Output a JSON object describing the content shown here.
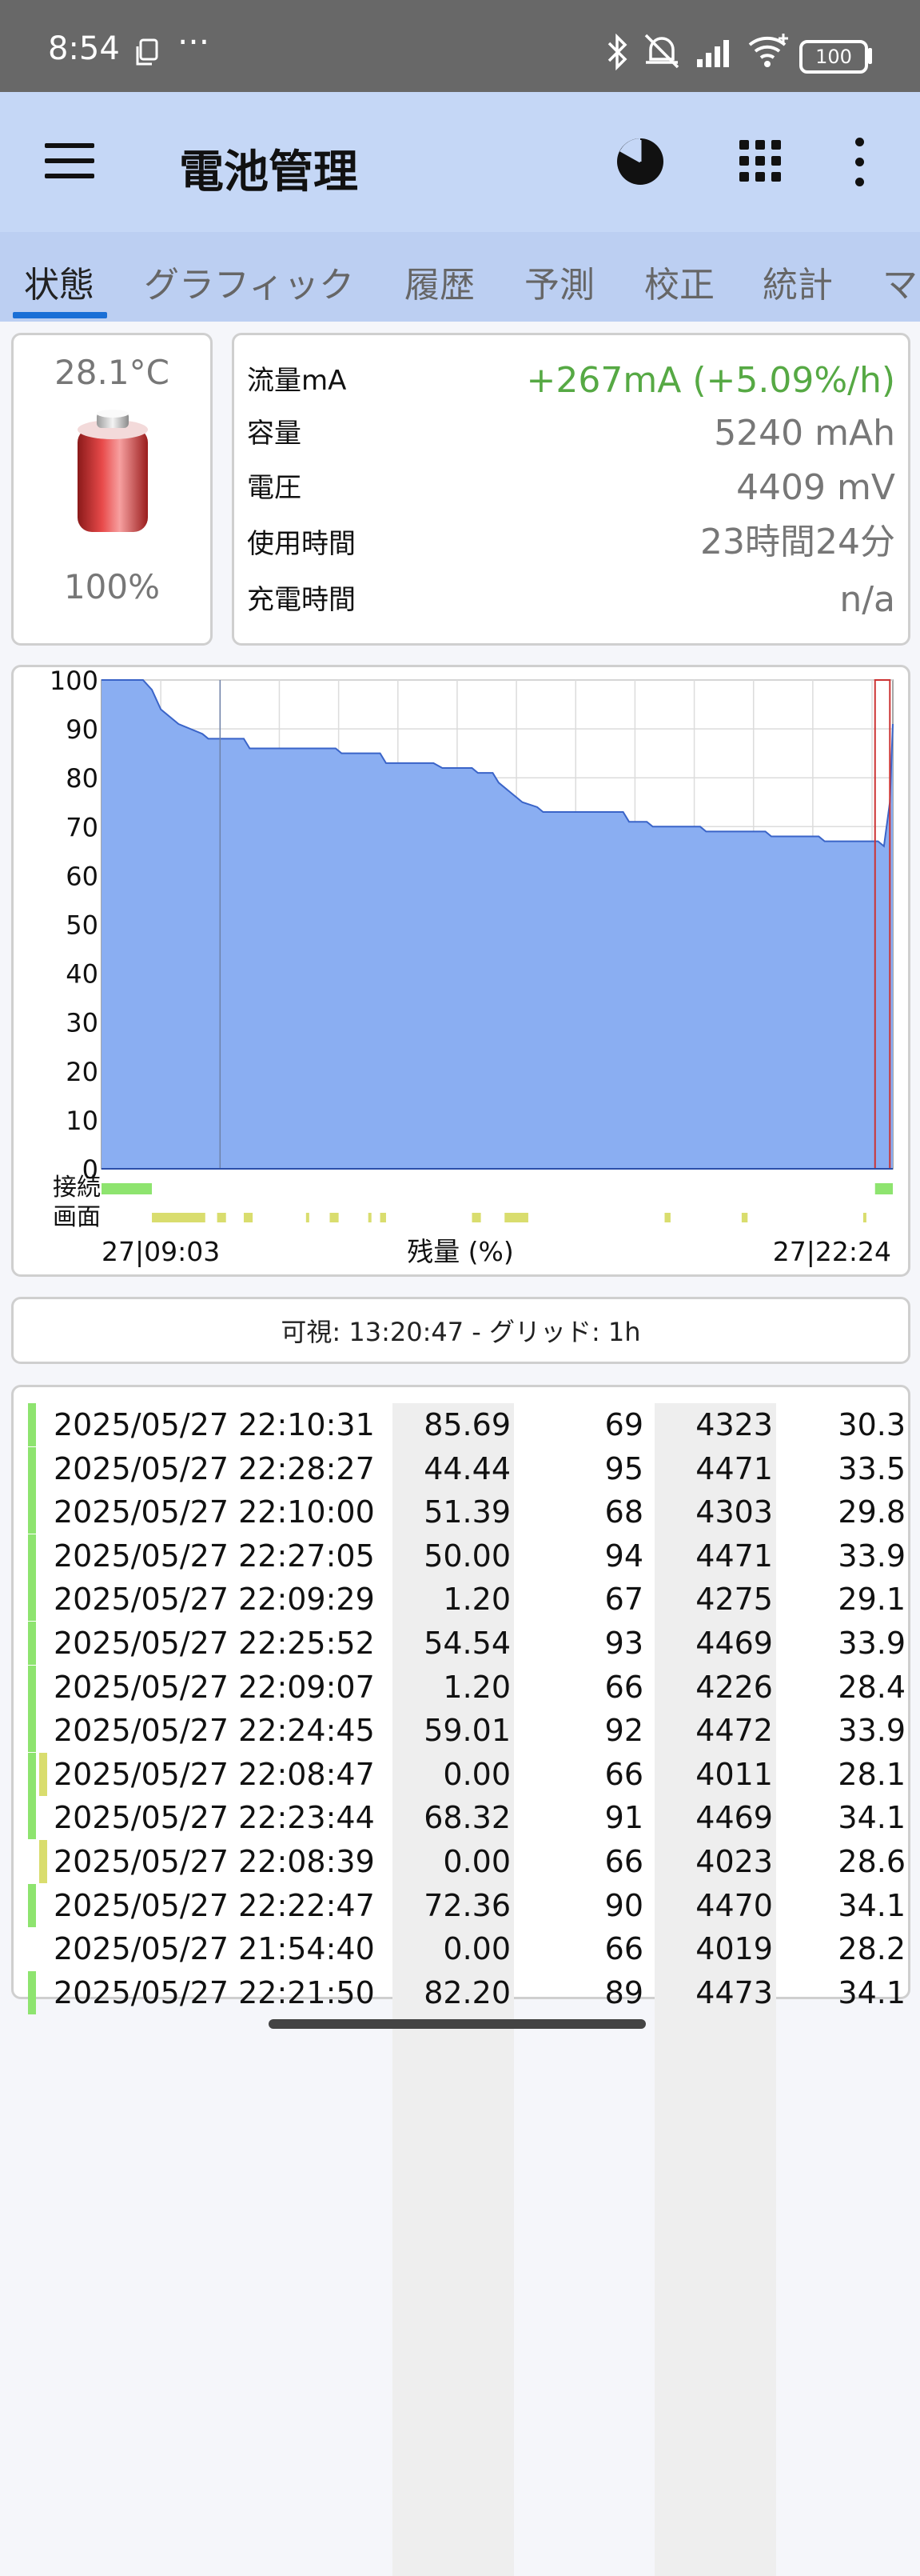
{
  "status_bar": {
    "time": "8:54",
    "battery_level": "100",
    "icons": [
      "copy-icon",
      "more-notifications-icon",
      "bluetooth-icon",
      "mute-icon",
      "signal-icon",
      "wifi-icon",
      "battery-icon"
    ]
  },
  "app_bar": {
    "title": "電池管理",
    "icons": [
      "menu-icon",
      "pie-chart-icon",
      "grid-icon",
      "more-vert-icon"
    ]
  },
  "tabs": [
    {
      "label": "状態",
      "active": true
    },
    {
      "label": "グラフィック",
      "active": false
    },
    {
      "label": "履歴",
      "active": false
    },
    {
      "label": "予測",
      "active": false
    },
    {
      "label": "校正",
      "active": false
    },
    {
      "label": "統計",
      "active": false
    },
    {
      "label": "マ",
      "active": false
    }
  ],
  "battery_card": {
    "temperature": "28.1°C",
    "level": "100%"
  },
  "info": [
    {
      "label": "流量mA",
      "value": "+267mA (+5.09%/h)"
    },
    {
      "label": "容量",
      "value": "5240 mAh"
    },
    {
      "label": "電圧",
      "value": "4409 mV"
    },
    {
      "label": "使用時間",
      "value": "23時間24分"
    },
    {
      "label": "充電時間",
      "value": "n/a"
    }
  ],
  "chart_data": {
    "type": "area",
    "title": "",
    "xlabel": "残量 (%)",
    "ylabel": "",
    "x_start_label": "27|09:03",
    "x_end_label": "27|22:24",
    "ylim": [
      0,
      100
    ],
    "yticks": [
      0,
      10,
      20,
      30,
      40,
      50,
      60,
      70,
      80,
      90,
      100
    ],
    "x_range_hours": [
      0,
      13.35
    ],
    "grid": "on, 1h vertical",
    "fill_color": "#8aaef2",
    "line_color": "#3a64c8",
    "series": [
      {
        "x": [
          0,
          0.7,
          0.85,
          1.0,
          1.3,
          1.7,
          1.8,
          2.4,
          2.5,
          3.2,
          3.3,
          3.95,
          4.05,
          4.7,
          4.8,
          5.6,
          5.75,
          6.25,
          6.35,
          6.6,
          6.7,
          6.8,
          7.0,
          7.1,
          7.35,
          7.45,
          8.8,
          8.9,
          9.2,
          9.3,
          10.1,
          10.2,
          11.2,
          11.3,
          12.1,
          12.2,
          13.1,
          13.2,
          13.3,
          13.35
        ],
        "y": [
          100,
          100,
          98,
          94,
          91,
          89,
          88,
          88,
          86,
          86,
          86,
          86,
          85,
          85,
          83,
          83,
          82,
          82,
          81,
          81,
          79,
          78,
          76,
          75,
          74,
          73,
          73,
          71,
          71,
          70,
          70,
          69,
          69,
          68,
          68,
          67,
          67,
          66,
          75,
          91
        ]
      }
    ],
    "connected_label": "接続",
    "connected_color": "#8ee46f",
    "connected_segments": [
      [
        0,
        0.85
      ],
      [
        13.05,
        13.35
      ]
    ],
    "screen_label": "画面",
    "screen_color": "#d9dd6e",
    "screen_segments": [
      [
        0.85,
        1.75
      ],
      [
        1.95,
        2.1
      ],
      [
        2.4,
        2.55
      ],
      [
        3.45,
        3.5
      ],
      [
        3.85,
        4.0
      ],
      [
        4.5,
        4.55
      ],
      [
        4.7,
        4.8
      ],
      [
        6.25,
        6.4
      ],
      [
        6.8,
        7.2
      ],
      [
        9.5,
        9.6
      ],
      [
        10.8,
        10.9
      ],
      [
        12.85,
        12.9
      ]
    ],
    "selection_box_color": "#cc3333"
  },
  "visible_bar": {
    "text": "可視: 13:20:47 - グリッド: 1h"
  },
  "table": {
    "rows": [
      {
        "datetime": "2025/05/27 22:10:31",
        "current": "85.69",
        "level": "69",
        "voltage": "4323",
        "temp": "30.3",
        "bar": "green"
      },
      {
        "datetime": "2025/05/27 22:28:27",
        "current": "44.44",
        "level": "95",
        "voltage": "4471",
        "temp": "33.5",
        "bar": "green"
      },
      {
        "datetime": "2025/05/27 22:10:00",
        "current": "51.39",
        "level": "68",
        "voltage": "4303",
        "temp": "29.8",
        "bar": "green"
      },
      {
        "datetime": "2025/05/27 22:27:05",
        "current": "50.00",
        "level": "94",
        "voltage": "4471",
        "temp": "33.9",
        "bar": "green"
      },
      {
        "datetime": "2025/05/27 22:09:29",
        "current": "1.20",
        "level": "67",
        "voltage": "4275",
        "temp": "29.1",
        "bar": "green"
      },
      {
        "datetime": "2025/05/27 22:25:52",
        "current": "54.54",
        "level": "93",
        "voltage": "4469",
        "temp": "33.9",
        "bar": "green"
      },
      {
        "datetime": "2025/05/27 22:09:07",
        "current": "1.20",
        "level": "66",
        "voltage": "4226",
        "temp": "28.4",
        "bar": "green"
      },
      {
        "datetime": "2025/05/27 22:24:45",
        "current": "59.01",
        "level": "92",
        "voltage": "4472",
        "temp": "33.9",
        "bar": "green"
      },
      {
        "datetime": "2025/05/27 22:08:47",
        "current": "0.00",
        "level": "66",
        "voltage": "4011",
        "temp": "28.1",
        "bar": "green-yellow"
      },
      {
        "datetime": "2025/05/27 22:23:44",
        "current": "68.32",
        "level": "91",
        "voltage": "4469",
        "temp": "34.1",
        "bar": "green"
      },
      {
        "datetime": "2025/05/27 22:08:39",
        "current": "0.00",
        "level": "66",
        "voltage": "4023",
        "temp": "28.6",
        "bar": "yellow"
      },
      {
        "datetime": "2025/05/27 22:22:47",
        "current": "72.36",
        "level": "90",
        "voltage": "4470",
        "temp": "34.1",
        "bar": "green"
      },
      {
        "datetime": "2025/05/27 21:54:40",
        "current": "0.00",
        "level": "66",
        "voltage": "4019",
        "temp": "28.2",
        "bar": "none"
      },
      {
        "datetime": "2025/05/27 22:21:50",
        "current": "82.20",
        "level": "89",
        "voltage": "4473",
        "temp": "34.1",
        "bar": "green"
      }
    ]
  }
}
